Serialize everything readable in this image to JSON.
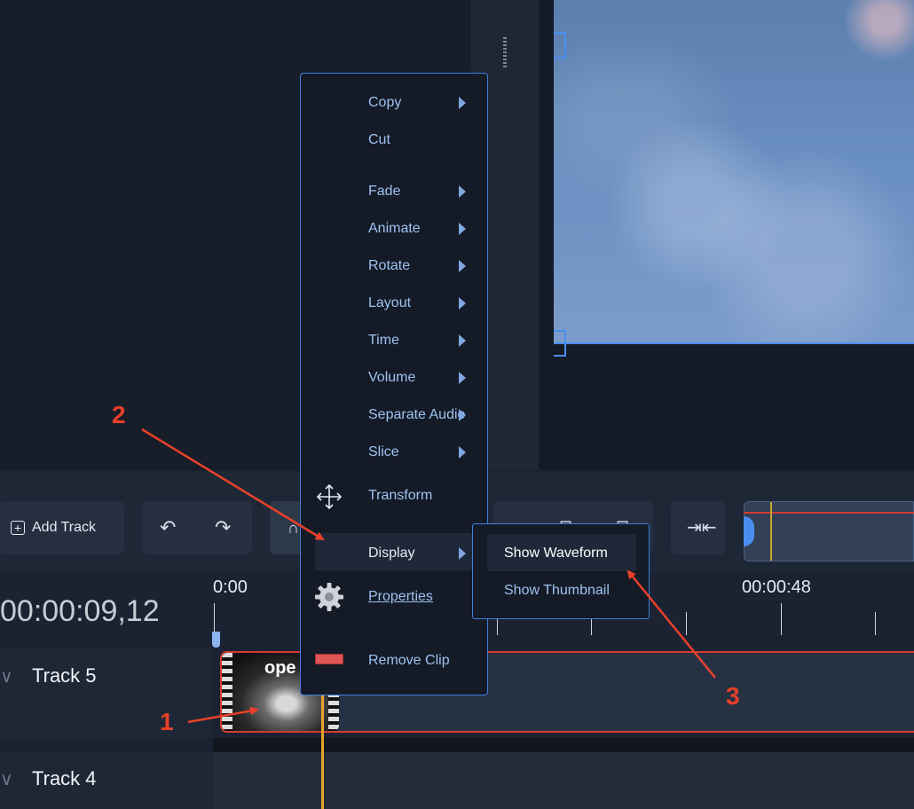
{
  "toolbar": {
    "add_track_label": "Add Track"
  },
  "timeline": {
    "current_timecode": "00:00:09,12",
    "ruler_labels": [
      "0:00",
      "00:00:48"
    ],
    "tracks": [
      {
        "label": "Track 5"
      },
      {
        "label": "Track 4"
      }
    ],
    "clip": {
      "title": "ope"
    }
  },
  "context_menu": {
    "items": [
      {
        "label": "Copy",
        "submenu": true
      },
      {
        "label": "Cut",
        "submenu": false
      },
      {
        "label": "Fade",
        "submenu": true
      },
      {
        "label": "Animate",
        "submenu": true
      },
      {
        "label": "Rotate",
        "submenu": true
      },
      {
        "label": "Layout",
        "submenu": true
      },
      {
        "label": "Time",
        "submenu": true
      },
      {
        "label": "Volume",
        "submenu": true
      },
      {
        "label": "Separate Audio",
        "submenu": true
      },
      {
        "label": "Slice",
        "submenu": true
      },
      {
        "label": "Transform",
        "icon": "move-arrows-icon"
      },
      {
        "label": "Display",
        "submenu": true,
        "highlighted": true
      },
      {
        "label": "Properties",
        "icon": "gear-icon"
      },
      {
        "label": "Remove Clip",
        "icon": "remove-clip-icon"
      }
    ]
  },
  "display_submenu": {
    "items": [
      {
        "label": "Show Waveform",
        "highlighted": true
      },
      {
        "label": "Show Thumbnail"
      }
    ]
  },
  "annotations": {
    "markers": [
      "1",
      "2",
      "3"
    ]
  },
  "colors": {
    "accent_blue": "#4a8ef0",
    "annotation_red": "#e8402a",
    "playhead_orange": "#e8a42a",
    "clip_border_red": "#d63a32"
  }
}
